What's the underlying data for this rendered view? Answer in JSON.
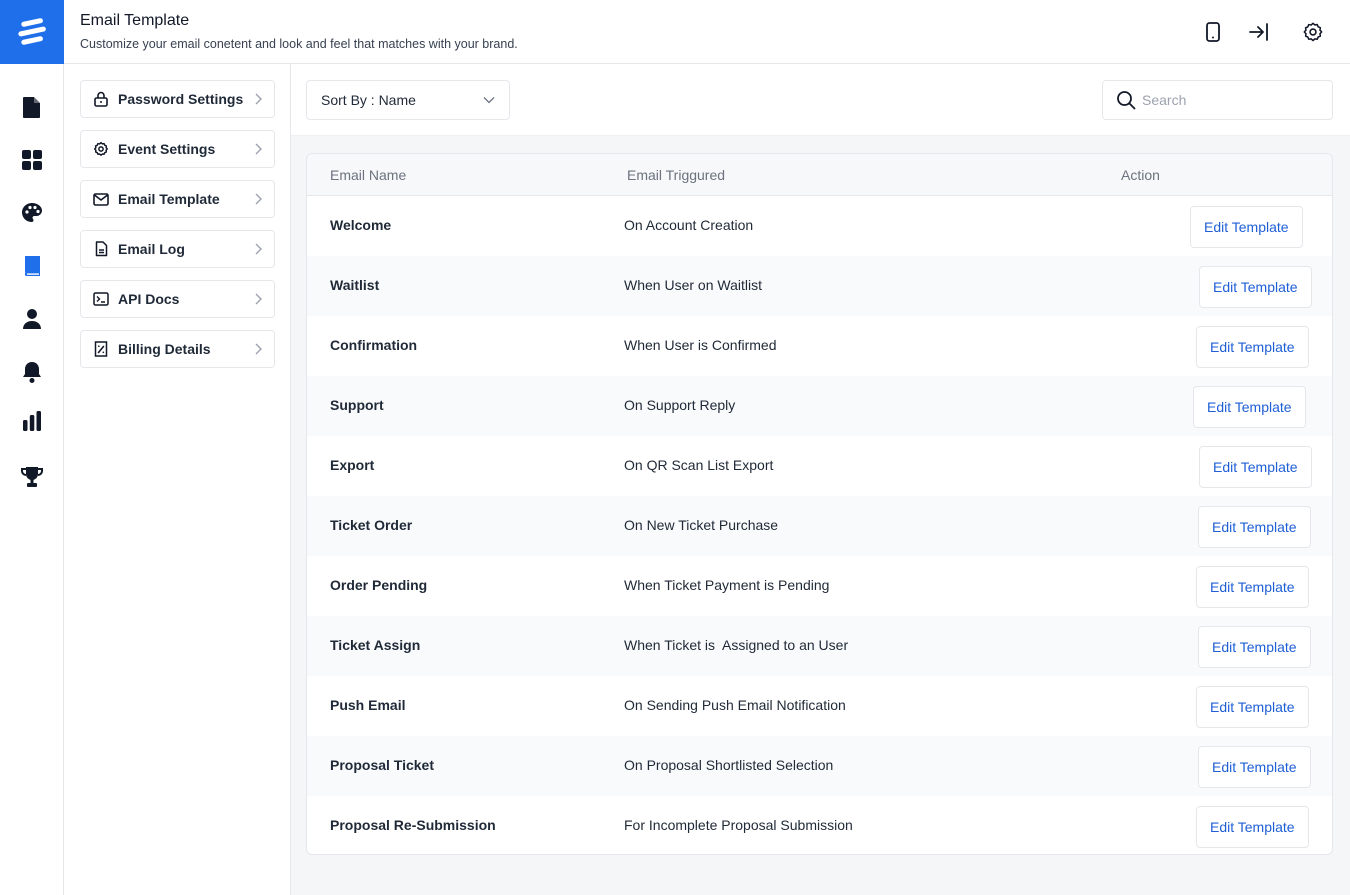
{
  "header": {
    "title": "Email Template",
    "subtitle": "Customize your email conetent and look and feel that matches with your brand.",
    "icons": [
      "mobile-icon",
      "login-arrow-icon",
      "settings-icon"
    ]
  },
  "rail": {
    "icons": [
      "document-icon",
      "dashboard-grid-icon",
      "palette-icon",
      "book-icon",
      "user-icon",
      "bell-icon",
      "bar-chart-icon",
      "trophy-icon"
    ],
    "active": "book-icon",
    "accent": "#1f6feb"
  },
  "subnav": {
    "items": [
      {
        "label": "Password Settings",
        "icon": "lock-icon"
      },
      {
        "label": "Event Settings",
        "icon": "gear-icon"
      },
      {
        "label": "Email Template",
        "icon": "mail-icon"
      },
      {
        "label": "Email Log",
        "icon": "file-icon"
      },
      {
        "label": "API Docs",
        "icon": "terminal-icon"
      },
      {
        "label": "Billing Details",
        "icon": "receipt-icon"
      }
    ]
  },
  "toolbar": {
    "sort_label": "Sort By : Name",
    "search_placeholder": "Search"
  },
  "table": {
    "columns": [
      "Email Name",
      "Email Triggured",
      "Action"
    ],
    "action_label": "Edit Template",
    "rows": [
      {
        "name": "Welcome",
        "trigger": "On Account Creation"
      },
      {
        "name": "Waitlist",
        "trigger": "When User on Waitlist"
      },
      {
        "name": "Confirmation",
        "trigger": "When User is Confirmed"
      },
      {
        "name": "Support",
        "trigger": "On Support Reply"
      },
      {
        "name": "Export",
        "trigger": "On QR Scan List Export"
      },
      {
        "name": "Ticket Order",
        "trigger": "On New Ticket Purchase"
      },
      {
        "name": "Order Pending",
        "trigger": "When Ticket Payment is Pending"
      },
      {
        "name": "Ticket Assign",
        "trigger": "When Ticket is  Assigned to an User"
      },
      {
        "name": "Push Email",
        "trigger": "On Sending Push Email Notification"
      },
      {
        "name": "Proposal Ticket",
        "trigger": "On Proposal Shortlisted Selection"
      },
      {
        "name": "Proposal Re-Submission",
        "trigger": "For Incomplete Proposal Submission"
      }
    ]
  }
}
